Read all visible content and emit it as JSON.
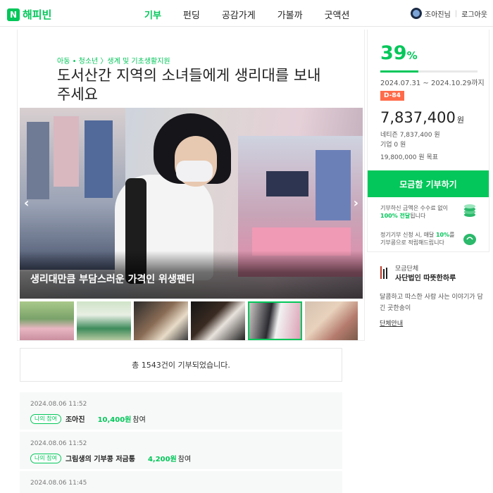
{
  "header": {
    "logo_mark": "N",
    "logo_text": "해피빈",
    "nav": [
      "기부",
      "펀딩",
      "공감가게",
      "가볼까",
      "굿액션"
    ],
    "user_name": "조아진님",
    "logout": "로그아웃"
  },
  "campaign": {
    "category": "아동 • 청소년 〉생계 및 기초생활지원",
    "title": "도서산간 지역의 소녀들에게 생리대를 보내 주세요",
    "hero_caption": "생리대만큼 부담스러운 가격인 위생팬티"
  },
  "stats": {
    "percent": "39",
    "percent_sign": "%",
    "progress": 0.39,
    "period": "2024.07.31 ~ 2024.10.29까지",
    "dday": "D-84",
    "amount": "7,837,400",
    "amount_unit": "원",
    "netizen": "네티즌 7,837,400 원",
    "company": "기업 0 원",
    "goal": "19,800,000 원 목표",
    "donate_button": "모금함 기부하기",
    "notice1_a": "기부하신 금액은 수수료 없이",
    "notice1_hl": "100% 전달",
    "notice1_b": "됩니다",
    "notice2_a": "정기기부 신청 시, 매달 ",
    "notice2_hl": "10%",
    "notice2_b": "를 기부콩으로 적립해드립니다"
  },
  "org": {
    "label": "모금단체",
    "name": "사단법인 따뜻한하루",
    "desc": "달콤하고 따스한 사람 사는 이야기가 담긴 곳한송이",
    "link": "단체안내"
  },
  "summary": "총 1543건이 기부되었습니다.",
  "donations": [
    {
      "date": "2024.08.06 11:52",
      "badge": "나의 참여",
      "name": "조아진",
      "amount": "10,400원",
      "suffix": "참여"
    },
    {
      "date": "2024.08.06 11:52",
      "badge": "나의 참여",
      "name": "그림생의 기부콩 저금통",
      "amount": "4,200원",
      "suffix": "참여"
    },
    {
      "date": "2024.08.06 11:45",
      "badge": "",
      "name": "",
      "amount": "",
      "suffix": ""
    }
  ],
  "colors": {
    "brand": "#03c75a",
    "dday": "#ff6b4a"
  }
}
